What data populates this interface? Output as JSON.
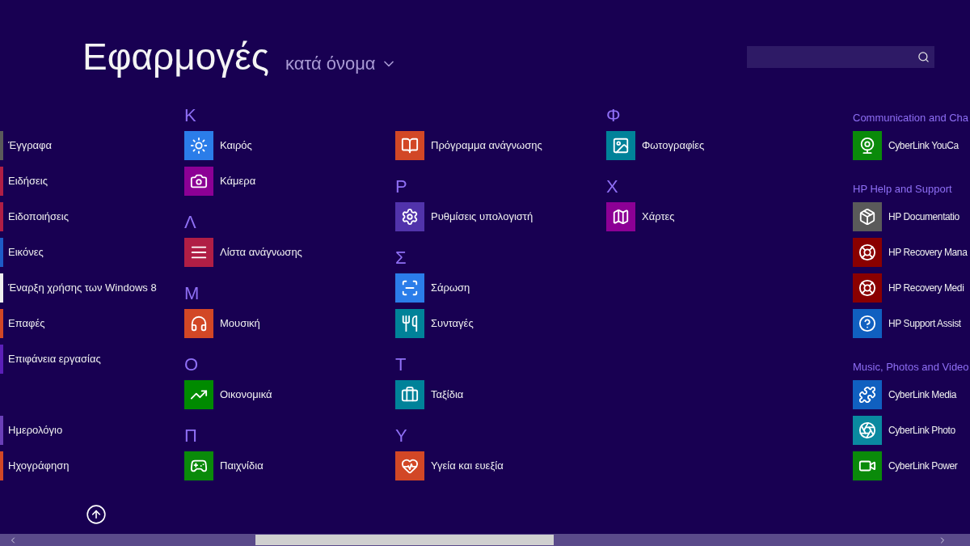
{
  "header": {
    "title": "Εφαρμογές",
    "sort": "κατά όνομα"
  },
  "columns": [
    {
      "clipped": true,
      "entries": [
        {
          "kind": "hidden_heading"
        },
        {
          "kind": "app",
          "name": "Έγγραφα",
          "color": "#5a5a5a"
        },
        {
          "kind": "app",
          "name": "Ειδήσεις",
          "color": "#b01e45"
        },
        {
          "kind": "app",
          "name": "Ειδοποιήσεις",
          "color": "#b01e45"
        },
        {
          "kind": "app",
          "name": "Εικόνες",
          "color": "#1e5bc6"
        },
        {
          "kind": "app",
          "name": "Έναρξη χρήσης των Windows 8",
          "color": "#f0f0f0"
        },
        {
          "kind": "app",
          "name": "Επαφές",
          "color": "#d24726"
        },
        {
          "kind": "app",
          "name": "Επιφάνεια εργασίας",
          "color": "#5b1fb8"
        },
        {
          "kind": "hidden_heading"
        },
        {
          "kind": "app",
          "name": "Ημερολόγιο",
          "color": "#6a3fb8"
        },
        {
          "kind": "app",
          "name": "Ηχογράφηση",
          "color": "#d24726"
        }
      ]
    },
    {
      "clipped": false,
      "entries": [
        {
          "kind": "heading",
          "text": "Κ"
        },
        {
          "kind": "app",
          "name": "Καιρός",
          "color": "#2b7de9"
        },
        {
          "kind": "app",
          "name": "Κάμερα",
          "color": "#8c0095"
        },
        {
          "kind": "heading",
          "text": "Λ"
        },
        {
          "kind": "app",
          "name": "Λίστα ανάγνωσης",
          "color": "#b01e45"
        },
        {
          "kind": "heading",
          "text": "Μ"
        },
        {
          "kind": "app",
          "name": "Μουσική",
          "color": "#d24726"
        },
        {
          "kind": "heading",
          "text": "Ο"
        },
        {
          "kind": "app",
          "name": "Οικονομικά",
          "color": "#008a00"
        },
        {
          "kind": "heading",
          "text": "Π"
        },
        {
          "kind": "app",
          "name": "Παιχνίδια",
          "color": "#0a8a0a"
        }
      ]
    },
    {
      "clipped": false,
      "entries": [
        {
          "kind": "hidden_heading"
        },
        {
          "kind": "app",
          "name": "Πρόγραμμα ανάγνωσης",
          "color": "#d24726"
        },
        {
          "kind": "heading",
          "text": "Ρ"
        },
        {
          "kind": "app",
          "name": "Ρυθμίσεις υπολογιστή",
          "color": "#5133ab"
        },
        {
          "kind": "heading",
          "text": "Σ"
        },
        {
          "kind": "app",
          "name": "Σάρωση",
          "color": "#2b7de9"
        },
        {
          "kind": "app",
          "name": "Συνταγές",
          "color": "#008299"
        },
        {
          "kind": "heading",
          "text": "Τ"
        },
        {
          "kind": "app",
          "name": "Ταξίδια",
          "color": "#008299"
        },
        {
          "kind": "heading",
          "text": "Υ"
        },
        {
          "kind": "app",
          "name": "Υγεία και ευεξία",
          "color": "#d24726"
        }
      ]
    },
    {
      "clipped": false,
      "entries": [
        {
          "kind": "heading",
          "text": "Φ"
        },
        {
          "kind": "app",
          "name": "Φωτογραφίες",
          "color": "#008299"
        },
        {
          "kind": "heading",
          "text": "Χ"
        },
        {
          "kind": "app",
          "name": "Χάρτες",
          "color": "#8c0095"
        }
      ]
    },
    {
      "clipped": false,
      "entries": [
        {
          "kind": "category",
          "text": "Communication and Cha"
        },
        {
          "kind": "app",
          "name": "CyberLink YouCa",
          "color": "#0a8a0a"
        },
        {
          "kind": "category",
          "text": "HP Help and Support"
        },
        {
          "kind": "app",
          "name": "HP Documentatio",
          "color": "#5a5a5a"
        },
        {
          "kind": "app",
          "name": "HP Recovery Mana",
          "color": "#8a0000"
        },
        {
          "kind": "app",
          "name": "HP Recovery Medi",
          "color": "#8a0000"
        },
        {
          "kind": "app",
          "name": "HP Support Assist",
          "color": "#1060c0"
        },
        {
          "kind": "category",
          "text": "Music, Photos and Video"
        },
        {
          "kind": "app",
          "name": "CyberLink Media",
          "color": "#1060c0"
        },
        {
          "kind": "app",
          "name": "CyberLink Photo",
          "color": "#0a8aa0"
        },
        {
          "kind": "app",
          "name": "CyberLink Power",
          "color": "#0a8a0a"
        }
      ]
    }
  ]
}
